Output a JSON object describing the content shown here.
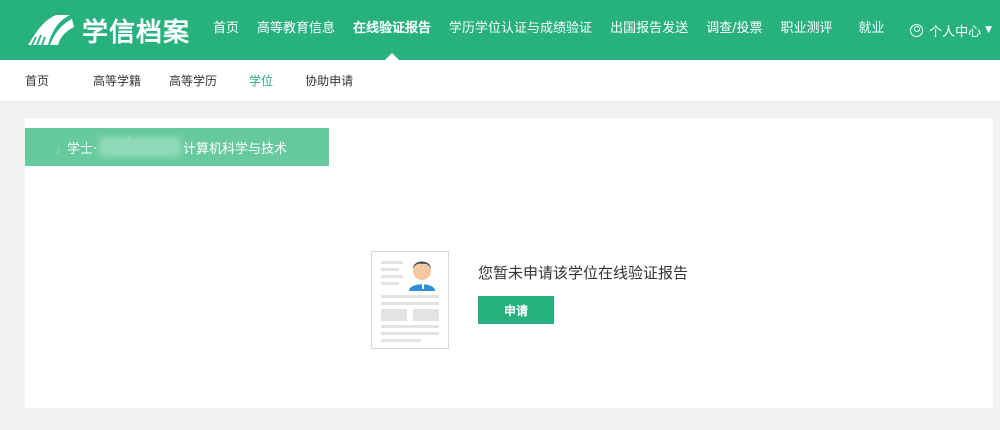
{
  "app": {
    "logo_text": "学信档案"
  },
  "top_nav": {
    "items": [
      {
        "label": "首页"
      },
      {
        "label": "高等教育信息"
      },
      {
        "label": "在线验证报告"
      },
      {
        "label": "学历学位认证与成绩验证"
      },
      {
        "label": "出国报告发送"
      },
      {
        "label": "调查/投票"
      },
      {
        "label": "职业测评"
      },
      {
        "label": "就业"
      }
    ],
    "active": "在线验证报告",
    "user_menu_label": "个人中心"
  },
  "sub_nav": {
    "items": [
      {
        "label": "首页"
      },
      {
        "label": "高等学籍"
      },
      {
        "label": "高等学历"
      },
      {
        "label": "学位"
      },
      {
        "label": "协助申请"
      }
    ],
    "active": "学位"
  },
  "degree_tab": {
    "degree_type": "学士·",
    "major": "计算机科学与技术"
  },
  "empty_state": {
    "message": "您暂未申请该学位在线验证报告",
    "button_label": "申请"
  },
  "colors": {
    "brand_green": "#26b17f",
    "tab_green": "#66ca9e"
  }
}
